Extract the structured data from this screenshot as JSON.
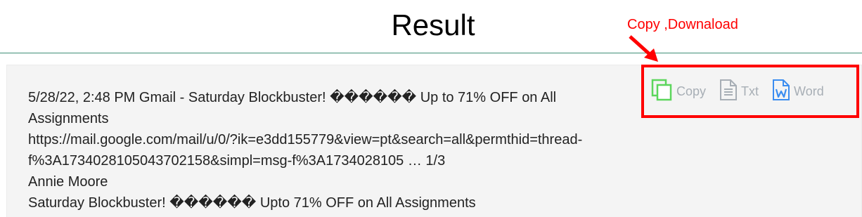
{
  "header": {
    "title": "Result"
  },
  "annotation": {
    "label": "Copy ,Downaload",
    "color": "#ff0000"
  },
  "toolbar": {
    "copy_label": "Copy",
    "txt_label": "Txt",
    "word_label": "Word",
    "copy_icon": "copy-icon",
    "txt_icon": "text-file-icon",
    "word_icon": "word-file-icon",
    "copy_color": "#5cd65c",
    "txt_color": "#a7aeb5",
    "word_color": "#3b8df0"
  },
  "result": {
    "lines": [
      "5/28/22, 2:48 PM Gmail - Saturday Blockbuster! ������ Up to 71% OFF on All",
      "Assignments",
      "https://mail.google.com/mail/u/0/?ik=e3dd155779&view=pt&search=all&permthid=thread-",
      "f%3A1734028105043702158&simpl=msg-f%3A1734028105 … 1/3",
      "Annie Moore",
      "Saturday Blockbuster! ������ Upto 71% OFF on All Assignments"
    ]
  },
  "colors": {
    "divider": "#3f8f77",
    "panel_bg": "#f4f4f4"
  }
}
